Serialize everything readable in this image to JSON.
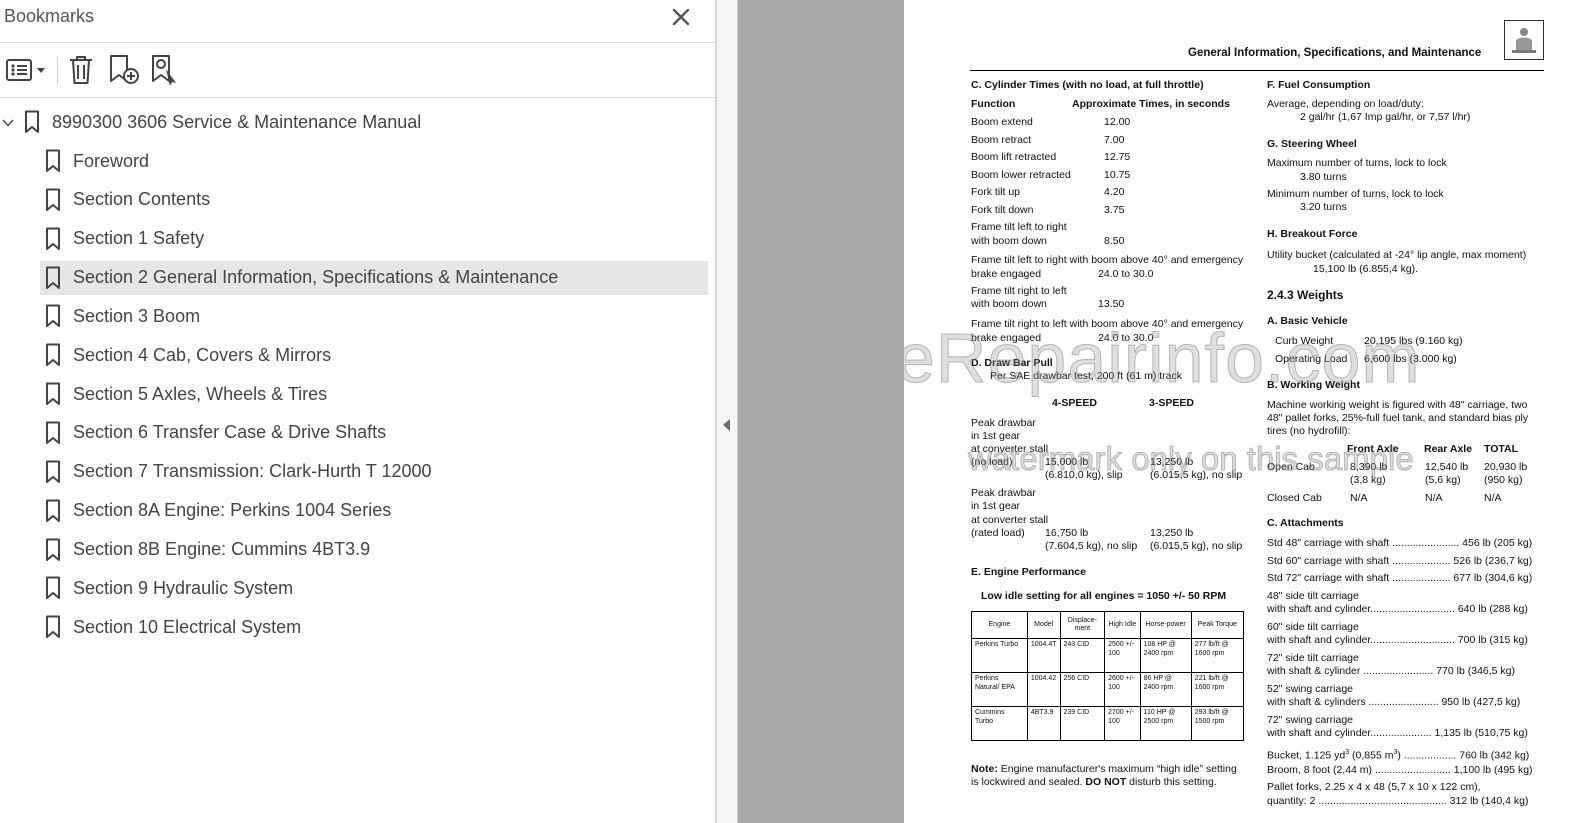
{
  "bookmarks": {
    "title": "Bookmarks",
    "root": "8990300 3606 Service & Maintenance Manual",
    "items": [
      {
        "label": "Foreword"
      },
      {
        "label": "Section Contents"
      },
      {
        "label": "Section 1 Safety"
      },
      {
        "label": "Section 2 General Information, Specifications & Maintenance",
        "selected": true
      },
      {
        "label": "Section 3 Boom"
      },
      {
        "label": "Section 4 Cab, Covers & Mirrors"
      },
      {
        "label": "Section 5 Axles, Wheels & Tires"
      },
      {
        "label": "Section 6 Transfer Case & Drive Shafts"
      },
      {
        "label": "Section 7 Transmission: Clark-Hurth T 12000"
      },
      {
        "label": "Section 8A Engine:  Perkins 1004 Series"
      },
      {
        "label": "Section 8B Engine:  Cummins 4BT3.9"
      },
      {
        "label": "Section 9 Hydraulic System"
      },
      {
        "label": "Section 10 Electrical System"
      }
    ],
    "icons": [
      "close-icon",
      "options-menu-icon",
      "delete-bookmark-icon",
      "new-bookmark-icon",
      "find-bookmark-icon",
      "bookmark-icon",
      "chevron-down-icon",
      "collapse-panel-arrow-icon"
    ]
  },
  "page": {
    "header": "General Information, Specifications, and Maintenance",
    "watermark_main": "eRepairinfo.com",
    "watermark_sub": "watermark only on this sample",
    "cyl": {
      "title": "C.  Cylinder Times (with no load, at full throttle)",
      "col_function": "Function",
      "col_times": "Approximate Times, in seconds",
      "rows": [
        {
          "f": "Boom extend",
          "v": "12.00"
        },
        {
          "f": "Boom retract",
          "v": "7.00"
        },
        {
          "f": "Boom lift retracted",
          "v": "12.75"
        },
        {
          "f": "Boom lower retracted",
          "v": "10.75"
        },
        {
          "f": "Fork tilt up",
          "v": "4.20"
        },
        {
          "f": "Fork tilt down",
          "v": "3.75"
        }
      ],
      "ftr1": "Frame tilt left to right",
      "ftr2": "with boom down",
      "ftr_v": "8.50",
      "ftre1": "Frame tilt left to right with boom above 40° and emergency",
      "ftre2": "brake engaged",
      "ftre_v": "24.0 to 30.0",
      "ftl1": "Frame tilt right to left",
      "ftl2": "with boom down",
      "ftl_v": "13.50",
      "ftle1": "Frame tilt right to left with boom above 40° and emergency",
      "ftle2": "brake engaged",
      "ftle_v": "24.0 to 30.0"
    },
    "draw": {
      "title": "D.  Draw Bar Pull",
      "sub": "Per SAE drawbar test, 200 ft (61 m) track",
      "col4": "4-SPEED",
      "col3": "3-SPEED",
      "p1a": "Peak drawbar",
      "p1b": "in 1st gear",
      "p1c": "at converter stall",
      "p1d": "(no load)",
      "p1_4a": "15,000 lb",
      "p1_4b": "(6.810,0 kg), slip",
      "p1_3a": "13,250 lb",
      "p1_3b": "(6.015,5 kg), no slip",
      "p2a": "Peak drawbar",
      "p2b": "in 1st gear",
      "p2c": "at converter stall",
      "p2d": "(rated load)",
      "p2_4a": "16,750 lb",
      "p2_4b": "(7.604,5 kg), no slip",
      "p2_3a": "13,250 lb",
      "p2_3b": "(6.015,5 kg), no slip"
    },
    "engine": {
      "title": "E.  Engine Performance",
      "idle": "Low idle setting for all engines = 1050 +/- 50 RPM",
      "headers": [
        "Engine",
        "Model",
        "Displace-ment",
        "High Idle",
        "Horse-power",
        "Peak Torque"
      ],
      "rows": [
        [
          "Perkins Turbo",
          "1004.4T",
          "243 CID",
          "2500 +/- 100",
          "108 HP @ 2400 rpm",
          "277 lb/ft @ 1600 rpm"
        ],
        [
          "Perkins Natural/ EPA",
          "1004.42",
          "256 CID",
          "2600 +/- 100",
          "86 HP @ 2400 rpm",
          "221 lb/ft @ 1600 rpm"
        ],
        [
          "Cummins Turbo",
          "4BT3.9",
          "239 CID",
          "2700 +/- 100",
          "110 HP @ 2500 rpm",
          "293 lb/ft @ 1500 rpm"
        ]
      ],
      "note_label": "Note:",
      "note1": "Engine manufacturer's maximum “high idle” setting",
      "note2a": "is lockwired and sealed.",
      "note2b": "DO NOT",
      "note2c": "disturb this setting."
    },
    "fuel": {
      "title": "F.   Fuel Consumption",
      "l1": "Average, depending on load/duty:",
      "l2": "2 gal/hr (1,67 Imp gal/hr, or 7,57 l/hr)"
    },
    "steer": {
      "title": "G.  Steering Wheel",
      "max": "Maximum number of turns, lock to lock",
      "max_v": "3.80 turns",
      "min": "Minimum number of turns, lock to lock",
      "min_v": "3.20 turns"
    },
    "breakout": {
      "title": "H.  Breakout Force",
      "l1": "Utility bucket (calculated at -24° lip angle, max moment)",
      "l2": "15,100 lb (6.855,4 kg)."
    },
    "weights": {
      "title": "2.4.3     Weights",
      "basic_title": "A.  Basic Vehicle",
      "curb": "Curb Weight",
      "curb_v": "20,195 lbs (9.160 kg)",
      "op": "Operating Load",
      "op_v": "6,600 lbs (3.000 kg)",
      "work_title": "B.  Working Weight",
      "work1": "Machine working weight is figured with 48\" carriage, two",
      "work2": "48\" pallet forks, 25%-full fuel tank, and standard bias ply",
      "work3": "tires (no hydrofill):",
      "front": "Front Axle",
      "rear": "Rear Axle",
      "total": "TOTAL",
      "open": "Open Cab",
      "open_f1": "8,390 lb",
      "open_f2": "(3,8 kg)",
      "open_r1": "12,540 lb",
      "open_r2": "(5,6 kg)",
      "open_t1": "20,930 lb",
      "open_t2": "(950 kg)",
      "closed": "Closed Cab",
      "na": "N/A"
    },
    "attach": {
      "title": "C.  Attachments",
      "items": [
        {
          "a": "Std 48\" carriage with shaft ....................... 456 lb (205 kg)"
        },
        {
          "a": "Std 60\" carriage with shaft .................... 526 lb (236,7 kg)"
        },
        {
          "a": "Std 72\" carriage with shaft .................... 677 lb (304,6 kg)"
        },
        {
          "a": "48\" side tilt carriage",
          "b": "with shaft and cylinder............................. 640 lb (288 kg)"
        },
        {
          "a": "60\" side tilt carriage",
          "b": "with shaft and cylinder............................. 700 lb (315 kg)"
        },
        {
          "a": "72\" side tilt carriage",
          "b": "with shaft & cylinder ........................ 770 lb (346,5 kg)"
        },
        {
          "a": "52\" swing carriage",
          "b": "with shaft & cylinders ........................ 950 lb (427,5 kg)"
        },
        {
          "a": "72\" swing carriage",
          "b": "with shaft and cylinder..................... 1,135 lb (510,75 kg)"
        }
      ],
      "bucket_a": "Bucket, 1.125 yd",
      "bucket_b": "3",
      "bucket_c": " (0,855 m",
      "bucket_d": "3",
      "bucket_e": ") .................. 760 lb (342 kg)",
      "broom": "Broom, 8 foot (2,44 m) .......................... 1,100 lb (495 kg)",
      "pallet1": "Pallet forks, 2.25 x 4 x 48 (5,7 x 10 x 122 cm),",
      "pallet2": "quantity: 2 ............................................ 312 lb (140,4 kg)"
    }
  }
}
